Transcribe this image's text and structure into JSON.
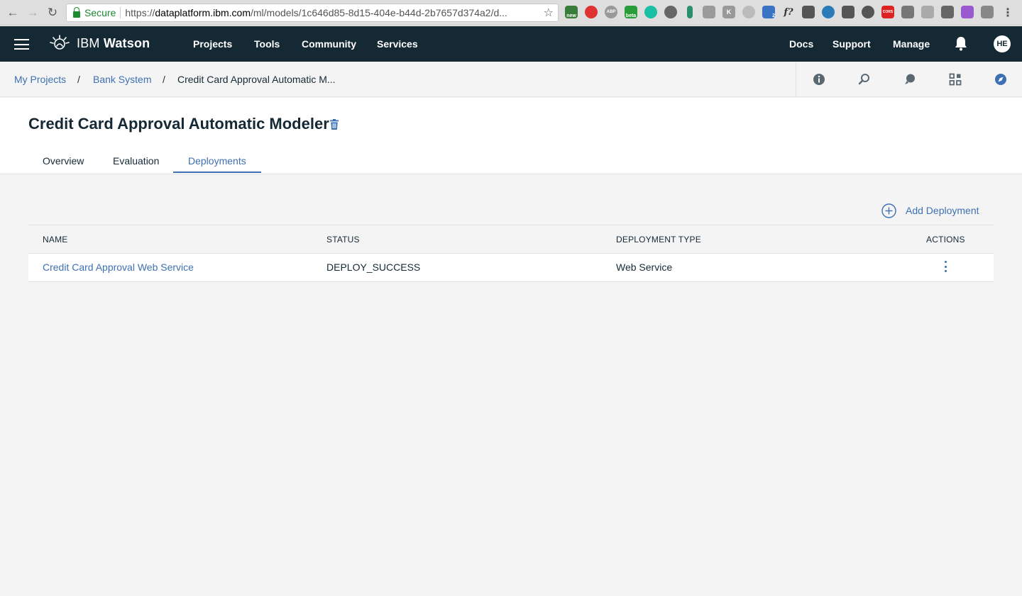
{
  "browser": {
    "secure_label": "Secure",
    "url_scheme": "https://",
    "url_host": "dataplatform.ibm.com",
    "url_path": "/ml/models/1c646d85-8d15-404e-b44d-2b7657d374a2/d...",
    "ext_new_badge": "new",
    "ext_abp": "ABP",
    "ext_beta_badge": "beta",
    "ext_count_badge": "2",
    "ext_fx": "f?",
    "ext_cors": "CORS",
    "ext_k": "K"
  },
  "appbar": {
    "brand_prefix": "IBM",
    "brand_name": "Watson",
    "nav": [
      "Projects",
      "Tools",
      "Community",
      "Services"
    ],
    "right_nav": [
      "Docs",
      "Support",
      "Manage"
    ],
    "avatar_initials": "HE"
  },
  "breadcrumb": {
    "items": [
      "My Projects",
      "Bank System",
      "Credit Card Approval Automatic M..."
    ],
    "separator": "/"
  },
  "page": {
    "title": "Credit Card Approval Automatic Modeler",
    "tabs": [
      "Overview",
      "Evaluation",
      "Deployments"
    ],
    "active_tab": "Deployments"
  },
  "deployments": {
    "add_label": "Add Deployment",
    "columns": [
      "NAME",
      "STATUS",
      "DEPLOYMENT TYPE",
      "ACTIONS"
    ],
    "rows": [
      {
        "name": "Credit Card Approval Web Service",
        "status": "DEPLOY_SUCCESS",
        "type": "Web Service"
      }
    ]
  },
  "colors": {
    "header_bg": "#152935",
    "link": "#3d70b2",
    "page_bg": "#f4f4f4"
  }
}
